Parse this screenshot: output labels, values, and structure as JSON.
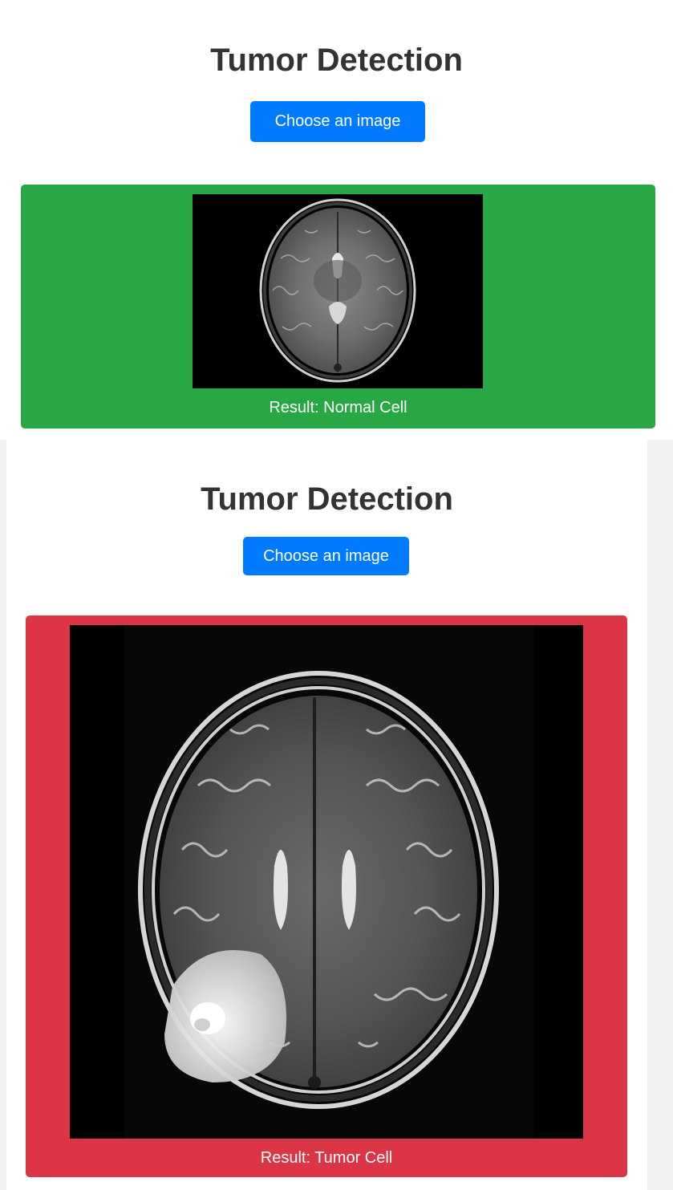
{
  "panels": [
    {
      "title": "Tumor Detection",
      "choose_button": "Choose an image",
      "result_text": "Result: Normal Cell",
      "result_color": "#28a745"
    },
    {
      "title": "Tumor Detection",
      "choose_button": "Choose an image",
      "result_text": "Result: Tumor Cell",
      "result_color": "#dc3545"
    }
  ],
  "button_color": "#007bff"
}
